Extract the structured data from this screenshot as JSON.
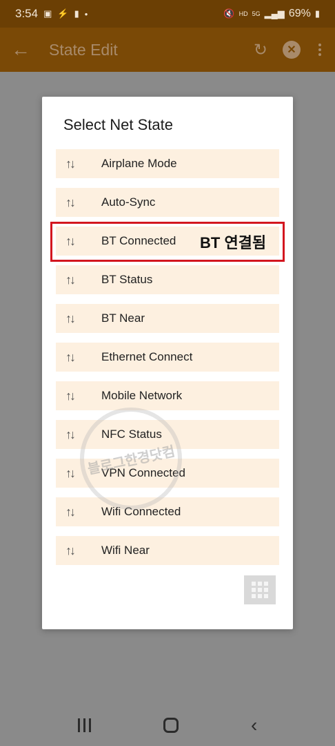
{
  "status_bar": {
    "time": "3:54",
    "battery": "69%",
    "left_icons": [
      "image-icon",
      "flash-icon",
      "nfc-icon",
      "dot-icon"
    ],
    "right_icons": [
      "mute-icon",
      "hd-voice-icon",
      "lte-icon",
      "signal-icon",
      "battery-icon"
    ]
  },
  "app_bar": {
    "title": "State Edit",
    "back_icon": "arrow-left-icon",
    "actions": [
      "refresh-icon",
      "close-circle-icon",
      "more-vert-icon"
    ]
  },
  "dialog": {
    "title": "Select Net State",
    "items": [
      {
        "label": "Airplane Mode",
        "icon": "swap-vert-icon"
      },
      {
        "label": "Auto-Sync",
        "icon": "swap-vert-icon"
      },
      {
        "label": "BT Connected",
        "icon": "swap-vert-icon"
      },
      {
        "label": "BT Status",
        "icon": "swap-vert-icon"
      },
      {
        "label": "BT Near",
        "icon": "swap-vert-icon"
      },
      {
        "label": "Ethernet Connect",
        "icon": "swap-vert-icon"
      },
      {
        "label": "Mobile Network",
        "icon": "swap-vert-icon"
      },
      {
        "label": "NFC Status",
        "icon": "swap-vert-icon"
      },
      {
        "label": "VPN Connected",
        "icon": "swap-vert-icon"
      },
      {
        "label": "Wifi Connected",
        "icon": "swap-vert-icon"
      },
      {
        "label": "Wifi Near",
        "icon": "swap-vert-icon"
      }
    ],
    "grid_button_icon": "grid-icon"
  },
  "annotation": {
    "text": "BT 연결됨",
    "highlight_color": "#d3161f"
  },
  "watermark": {
    "text": "블로그한경닷컴"
  },
  "colors": {
    "app_bar": "#7a4906",
    "item_bg": "#fdf0e0"
  }
}
